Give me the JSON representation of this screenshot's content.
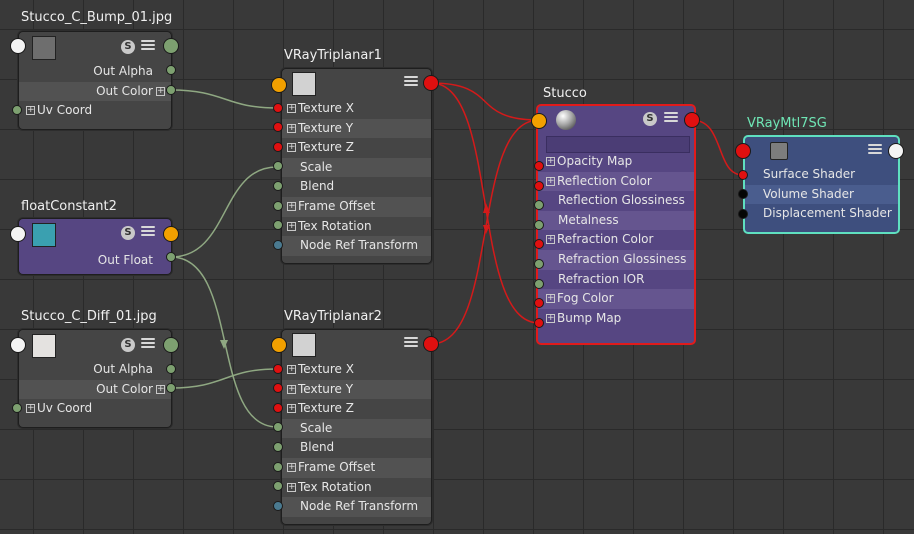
{
  "nodes": {
    "bump": {
      "title": "Stucco_C_Bump_01.jpg",
      "swatch_color": "#6e6e6e",
      "rows": [
        "Out Alpha",
        "Out Color",
        "Uv Coord"
      ]
    },
    "float": {
      "title": "floatConstant2",
      "swatch_color": "#3aa0b0",
      "rows": [
        "Out Float"
      ]
    },
    "diff": {
      "title": "Stucco_C_Diff_01.jpg",
      "swatch_color": "#e4e2e0",
      "rows": [
        "Out Alpha",
        "Out Color",
        "Uv Coord"
      ]
    },
    "tri1": {
      "title": "VRayTriplanar1",
      "swatch_color": "#d2d2d2",
      "rows": [
        "Texture X",
        "Texture Y",
        "Texture Z",
        "Scale",
        "Blend",
        "Frame Offset",
        "Tex Rotation",
        "Node Ref Transform"
      ]
    },
    "tri2": {
      "title": "VRayTriplanar2",
      "swatch_color": "#d2d2d2",
      "rows": [
        "Texture X",
        "Texture Y",
        "Texture Z",
        "Scale",
        "Blend",
        "Frame Offset",
        "Tex Rotation",
        "Node Ref Transform"
      ]
    },
    "stucco": {
      "title": "Stucco",
      "rows": [
        "Opacity Map",
        "Reflection Color",
        "Reflection Glossiness",
        "Metalness",
        "Refraction Color",
        "Refraction Glossiness",
        "Refraction IOR",
        "Fog Color",
        "Bump Map"
      ]
    },
    "sg": {
      "title": "VRayMtl7SG",
      "rows": [
        "Surface Shader",
        "Volume Shader",
        "Displacement Shader"
      ]
    }
  },
  "icons": {
    "s_badge": "S",
    "plus": "+"
  },
  "colors": {
    "wire_red": "#d41a1a",
    "wire_green": "#8fa882",
    "selected_border": "#e11b1b",
    "shading_group_border": "#5fe0c0"
  }
}
